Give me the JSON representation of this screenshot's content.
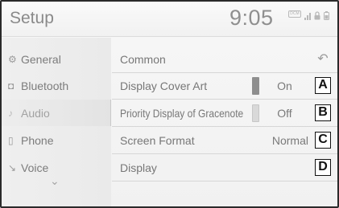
{
  "header": {
    "title": "Setup",
    "clock": "9:05",
    "badge": "DCM"
  },
  "sidebar": {
    "items": [
      {
        "label": "General",
        "icon": "⚙"
      },
      {
        "label": "Bluetooth",
        "icon": "◘"
      },
      {
        "label": "Audio",
        "icon": "♪"
      },
      {
        "label": "Phone",
        "icon": "▯"
      },
      {
        "label": "Voice",
        "icon": "↘"
      }
    ],
    "more": "⌄"
  },
  "content": {
    "section_title": "Common",
    "back_icon": "↶",
    "rows": [
      {
        "label": "Display Cover Art",
        "value": "On",
        "callout": "A"
      },
      {
        "label": "Priority Display of Gracenote",
        "value": "Off",
        "callout": "B"
      },
      {
        "label": "Screen Format",
        "value": "Normal",
        "callout": "C"
      },
      {
        "label": "Display",
        "value": "",
        "callout": "D"
      }
    ]
  }
}
